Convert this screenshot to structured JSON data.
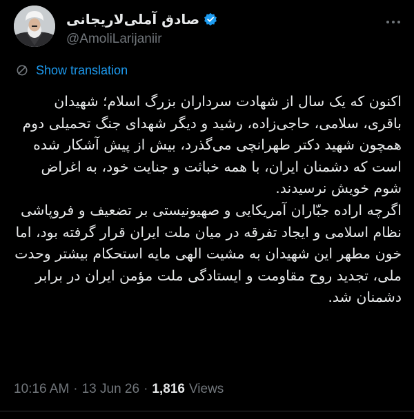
{
  "author": {
    "display_name": "صادق آملی‌لاریجانی",
    "handle": "@AmoliLarijaniir",
    "verified": true,
    "avatar_icon": "profile-photo"
  },
  "translation": {
    "label": "Show translation",
    "icon": "translate-icon",
    "color": "#1d9bf0"
  },
  "tweet": {
    "paragraph_1": "اکنون که یک سال از شهادت سرداران بزرگ اسلام؛ شهیدان باقری، سلامی، حاجی‌زاده، رشید و دیگر شهدای جنگ تحمیلی دوم همچون شهید دکتر طهرانچی می‌گذرد، بیش از پیش آشکار شده است که دشمنان ایران، با همه خباثت و جنایت خود، به اغراض شوم خویش نرسیدند.",
    "paragraph_2": "اگرچه اراده جبّاران آمریکایی و صهیونیستی بر تضعیف و فروپاشی نظام اسلامی و ایجاد تفرقه در میان ملت ایران قرار گرفته بود، اما خون مطهر این شهیدان به مشیت الهی مایه استحکام بیشتر وحدت ملی، تجدید روح مقاومت و ایستادگی ملت مؤمن ایران در برابر دشمنان شد."
  },
  "meta": {
    "time": "10:16 AM",
    "separator": "·",
    "date": "13 Jun 26",
    "views_count": "1,816",
    "views_label": "Views"
  },
  "colors": {
    "background": "#000000",
    "text": "#e7e9ea",
    "muted": "#71767b",
    "accent": "#1d9bf0",
    "verified": "#1d9bf0"
  }
}
